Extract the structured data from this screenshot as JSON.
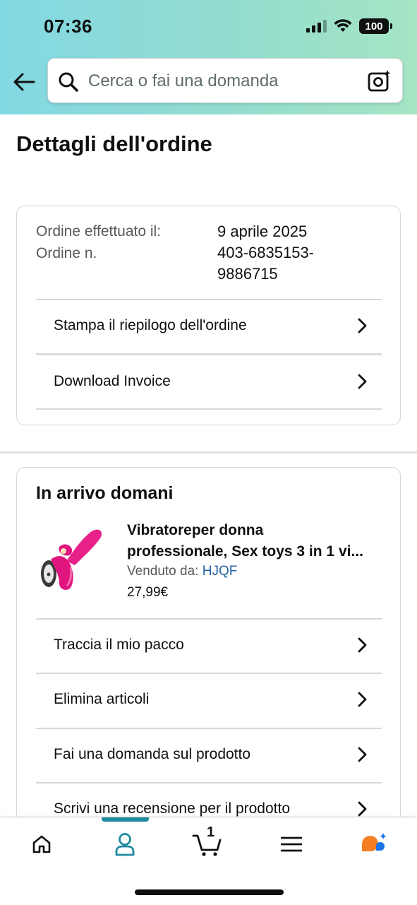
{
  "status_bar": {
    "time": "07:36",
    "battery": "100"
  },
  "search": {
    "placeholder": "Cerca o fai una domanda"
  },
  "page_title": "Dettagli dell'ordine",
  "order_summary": {
    "placed_label": "Ordine effettuato il:",
    "placed_value": "9 aprile 2025",
    "number_label": "Ordine n.",
    "number_line1": "403-6835153-",
    "number_line2": "9886715",
    "actions": [
      {
        "label": "Stampa il riepilogo dell'ordine"
      },
      {
        "label": "Download Invoice"
      }
    ]
  },
  "shipment": {
    "title": "In arrivo domani",
    "product_line1": "Vibratoreper donna",
    "product_line2": "professionale, Sex toys 3 in 1 vi...",
    "seller_label": "Venduto da: ",
    "seller_name": "HJQF",
    "price": "27,99€",
    "actions": [
      {
        "label": "Traccia il mio pacco"
      },
      {
        "label": "Elimina articoli"
      },
      {
        "label": "Fai una domanda sul prodotto"
      },
      {
        "label": "Scrivi una recensione per il prodotto"
      }
    ]
  },
  "bottom_nav": {
    "items": [
      {
        "icon": "home-icon"
      },
      {
        "icon": "account-icon",
        "active": true
      },
      {
        "icon": "cart-icon",
        "count": "1"
      },
      {
        "icon": "menu-icon"
      },
      {
        "icon": "rufus-assistant-icon"
      }
    ],
    "accent_color": "#1f8a9e"
  },
  "colors": {
    "link": "#2162a1",
    "header_gradient_start": "#82d8e3",
    "header_gradient_end": "#a5e5c4"
  }
}
